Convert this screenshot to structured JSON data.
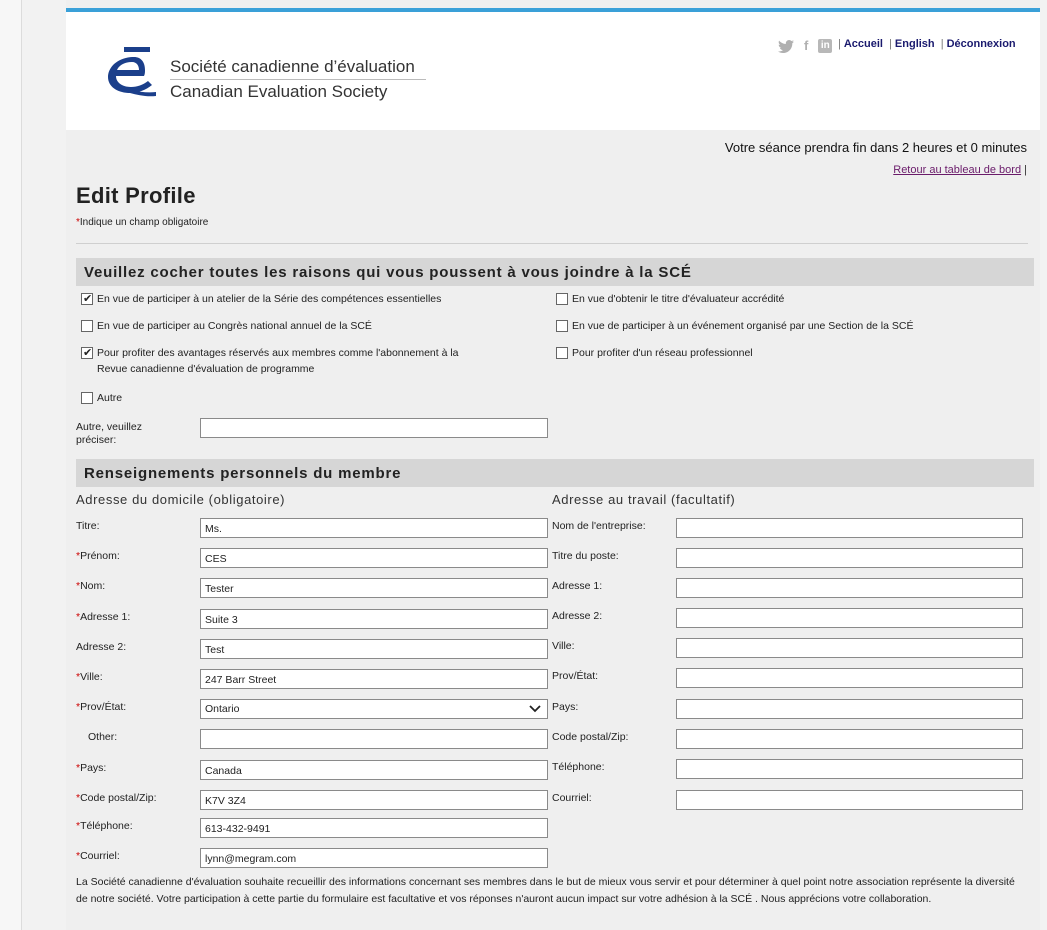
{
  "header": {
    "org_name_fr": "Société canadienne d’évaluation",
    "org_name_en": "Canadian Evaluation Society",
    "social": {
      "twitter_icon": "twitter-icon",
      "facebook_icon": "facebook-icon",
      "linkedin_icon": "linkedin-icon",
      "facebook_glyph": "f",
      "linkedin_glyph": "in"
    },
    "links": {
      "home": "Accueil",
      "english": "English",
      "logout": "Déconnexion"
    },
    "accent_color": "#3aa0d8"
  },
  "session": {
    "message": "Votre séance prendra fin dans 2 heures et 0 minutes",
    "dashboard_link": "Retour au tableau de bord"
  },
  "page": {
    "title": "Edit Profile",
    "required_note": "Indique un champ obligatoire"
  },
  "reasons": {
    "heading": "Veuillez cocher toutes les raisons qui vous poussent à vous joindre à la SCÉ",
    "items": [
      {
        "label": "En vue de participer à un atelier de la Série des compétences essentielles",
        "checked": true
      },
      {
        "label": "En vue d'obtenir le titre d'évaluateur accrédité",
        "checked": false
      },
      {
        "label": "En vue de participer au Congrès national annuel de la SCÉ",
        "checked": false
      },
      {
        "label": "En vue de participer à un événement organisé par une Section de la SCÉ",
        "checked": false
      },
      {
        "label_line1": "Pour profiter des avantages réservés aux membres comme l'abonnement à la",
        "label_line2": "Revue canadienne d'évaluation de programme",
        "checked": true
      },
      {
        "label": "Pour profiter d'un réseau professionnel",
        "checked": false
      },
      {
        "label": "Autre",
        "checked": false
      }
    ],
    "other_label_line1": "Autre, veuillez",
    "other_label_line2": "préciser:",
    "other_value": ""
  },
  "personal": {
    "heading": "Renseignements personnels du membre",
    "home": {
      "heading": "Adresse du domicile (obligatoire)",
      "fields": [
        {
          "label": "Titre:",
          "required": false,
          "value": "Ms."
        },
        {
          "label": "Prénom:",
          "required": true,
          "value": "CES"
        },
        {
          "label": "Nom:",
          "required": true,
          "value": "Tester"
        },
        {
          "label": "Adresse 1:",
          "required": true,
          "value": "Suite 3"
        },
        {
          "label": "Adresse 2:",
          "required": false,
          "value": "Test"
        },
        {
          "label": "Ville:",
          "required": true,
          "value": "247 Barr Street"
        },
        {
          "label": "Prov/État:",
          "required": true,
          "value": "Ontario",
          "type": "select"
        },
        {
          "label": "Other:",
          "required": false,
          "value": ""
        },
        {
          "label": "Pays:",
          "required": true,
          "value": "Canada"
        },
        {
          "label": "Code postal/Zip:",
          "required": true,
          "value": "K7V 3Z4"
        },
        {
          "label": "Téléphone:",
          "required": true,
          "value": "613-432-9491"
        },
        {
          "label": "Courriel:",
          "required": true,
          "value": "lynn@megram.com"
        }
      ]
    },
    "work": {
      "heading": "Adresse au travail (facultatif)",
      "fields": [
        {
          "label": "Nom de l'entreprise:",
          "value": ""
        },
        {
          "label": "Titre du poste:",
          "value": ""
        },
        {
          "label": "Adresse 1:",
          "value": ""
        },
        {
          "label": "Adresse 2:",
          "value": ""
        },
        {
          "label": "Ville:",
          "value": ""
        },
        {
          "label": "Prov/État:",
          "value": ""
        },
        {
          "label": "Pays:",
          "value": ""
        },
        {
          "label": "Code postal/Zip:",
          "value": ""
        },
        {
          "label": "Téléphone:",
          "value": ""
        },
        {
          "label": "Courriel:",
          "value": ""
        }
      ]
    }
  },
  "footer": {
    "text": "La Société canadienne d'évaluation souhaite recueillir des informations concernant ses membres dans le but de mieux vous servir et pour déterminer à quel point notre association représente la diversité de notre société. Votre participation à cette partie du formulaire est facultative et vos réponses n'auront aucun impact sur votre adhésion à la SCÉ . Nous apprécions votre collaboration."
  }
}
